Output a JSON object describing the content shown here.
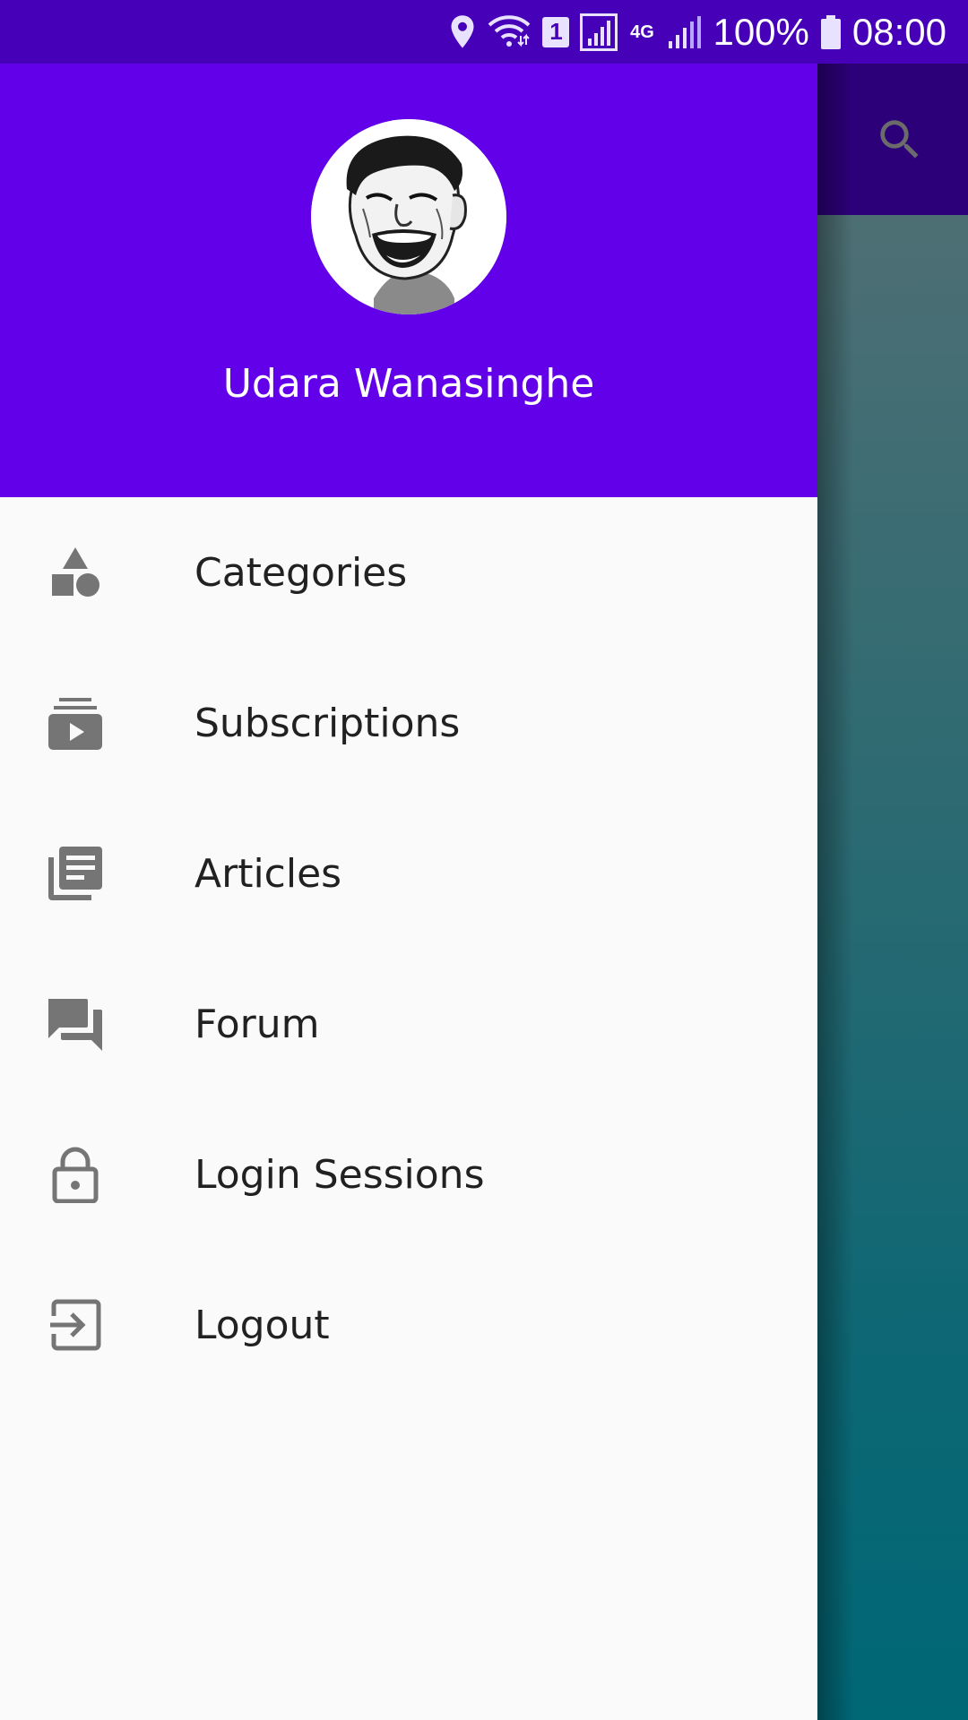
{
  "status_bar": {
    "sim_slot": "1",
    "network_type": "4G",
    "battery": "100%",
    "time": "08:00",
    "icons": [
      "location-icon",
      "wifi-icon",
      "sim-icon",
      "signal-icon",
      "network-4g-icon",
      "signal-weak-icon",
      "battery-icon"
    ]
  },
  "app_toolbar": {
    "search_icon": "search-icon"
  },
  "drawer": {
    "header": {
      "avatar": "avatar",
      "user_name": "Udara Wanasinghe"
    },
    "items": [
      {
        "label": "Categories",
        "icon": "shapes-icon"
      },
      {
        "label": "Subscriptions",
        "icon": "subscriptions-icon"
      },
      {
        "label": "Articles",
        "icon": "articles-icon"
      },
      {
        "label": "Forum",
        "icon": "forum-icon"
      },
      {
        "label": "Login Sessions",
        "icon": "lock-icon"
      },
      {
        "label": "Logout",
        "icon": "logout-icon"
      }
    ]
  },
  "colors": {
    "status_bar": "#4600b8",
    "drawer_header": "#6200ea",
    "app_toolbar_dimmed": "#2c0079",
    "drawer_background": "#fafafa",
    "menu_text": "#212121",
    "icon_gray": "#757575"
  }
}
